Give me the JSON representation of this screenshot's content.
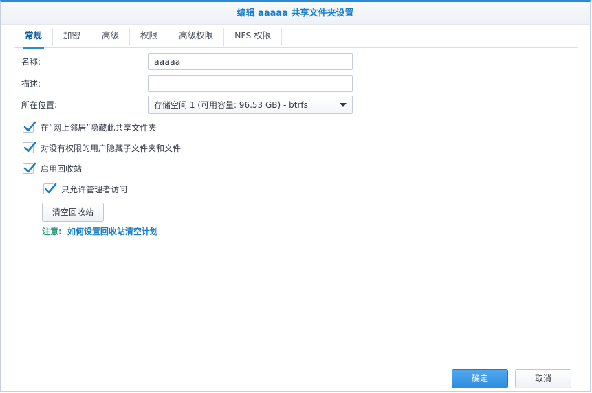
{
  "dialog": {
    "title": "编辑 aaaaa 共享文件夹设置"
  },
  "tabs": [
    {
      "label": "常规",
      "active": true
    },
    {
      "label": "加密"
    },
    {
      "label": "高级"
    },
    {
      "label": "权限"
    },
    {
      "label": "高级权限"
    },
    {
      "label": "NFS 权限"
    }
  ],
  "form": {
    "name_label": "名称:",
    "name_value": "aaaaa",
    "desc_label": "描述:",
    "desc_value": "",
    "location_label": "所在位置:",
    "location_value": "存储空间 1 (可用容量:  96.53 GB) - btrfs"
  },
  "options": {
    "hide_network": {
      "label": "在“网上邻居”隐藏此共享文件夹",
      "checked": true
    },
    "hide_subfolders": {
      "label": "对没有权限的用户隐藏子文件夹和文件",
      "checked": true
    },
    "recycle_bin": {
      "label": "启用回收站",
      "checked": true
    },
    "admin_only": {
      "label": "只允许管理者访问",
      "checked": true
    }
  },
  "empty_recycle_label": "清空回收站",
  "note": {
    "prefix": "注意:",
    "link": "如何设置回收站清空计划"
  },
  "footer": {
    "ok_label": "确定",
    "cancel_label": "取消"
  },
  "colors": {
    "accent": "#2d8ad9",
    "title": "#1b7fc7",
    "note_prefix": "#2a9a74"
  }
}
